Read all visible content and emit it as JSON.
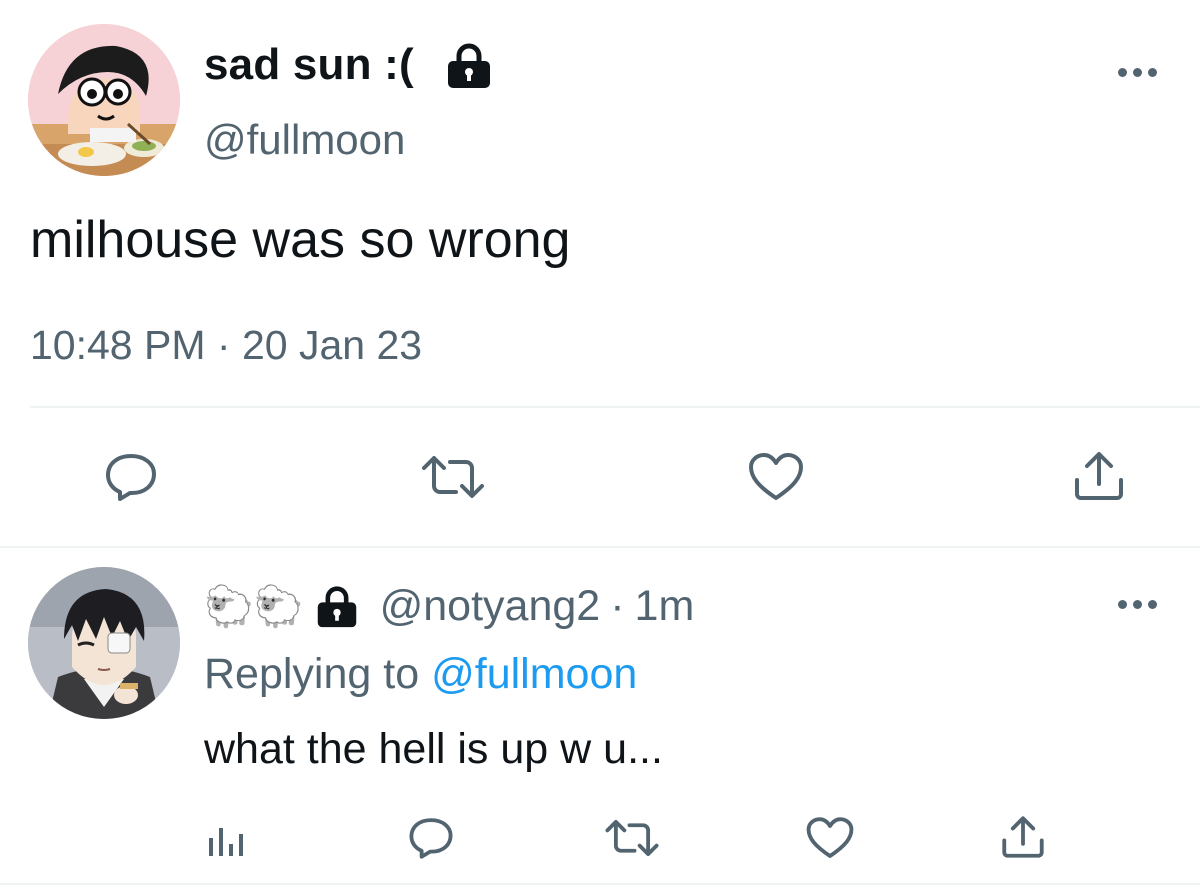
{
  "main_tweet": {
    "display_name": "sad sun :(",
    "handle": "@fullmoon",
    "text": "milhouse was so wrong",
    "time": "10:48 PM",
    "separator": "·",
    "date": "20 Jan 23",
    "protected_icon": "lock-icon",
    "more_icon": "more-horizontal-icon",
    "actions": [
      "reply-icon",
      "retweet-icon",
      "like-icon",
      "share-icon"
    ]
  },
  "reply_tweet": {
    "display_name_emoji": "🐑🐑",
    "protected_icon": "lock-icon",
    "handle": "@notyang2",
    "separator": "·",
    "age": "1m",
    "replying_prefix": "Replying to",
    "replying_mention": "@fullmoon",
    "text": "what the hell is up w u...",
    "more_icon": "more-horizontal-icon",
    "actions": [
      "analytics-icon",
      "reply-icon",
      "retweet-icon",
      "like-icon",
      "share-icon"
    ]
  },
  "colors": {
    "text": "#0f1419",
    "secondary": "#536471",
    "link": "#1d9bf0",
    "divider": "#eff3f4"
  }
}
